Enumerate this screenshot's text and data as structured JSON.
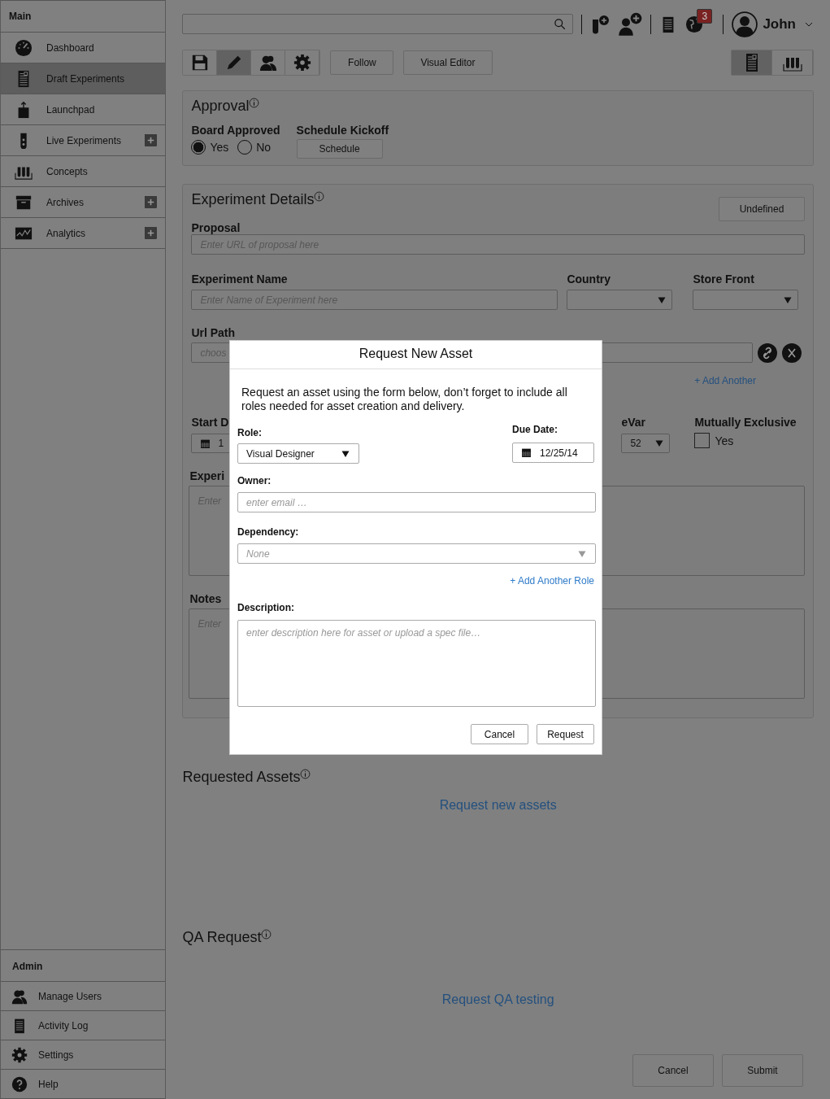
{
  "sidebar": {
    "main_heading": "Main",
    "items": [
      {
        "label": "Dashboard",
        "selected": false,
        "expandable": false
      },
      {
        "label": "Draft Experiments",
        "selected": true,
        "expandable": false
      },
      {
        "label": "Launchpad",
        "selected": false,
        "expandable": false
      },
      {
        "label": "Live Experiments",
        "selected": false,
        "expandable": true
      },
      {
        "label": "Concepts",
        "selected": false,
        "expandable": false
      },
      {
        "label": "Archives",
        "selected": false,
        "expandable": true
      },
      {
        "label": "Analytics",
        "selected": false,
        "expandable": true
      }
    ],
    "admin_heading": "Admin",
    "admin_items": [
      {
        "label": "Manage Users"
      },
      {
        "label": "Activity Log"
      },
      {
        "label": "Settings"
      },
      {
        "label": "Help"
      }
    ]
  },
  "topbar": {
    "notification_count": "3",
    "user_name": "John"
  },
  "toolbar": {
    "tools": [
      {
        "selected": false
      },
      {
        "selected": true
      },
      {
        "selected": false
      },
      {
        "selected": false
      }
    ],
    "buttons": [
      "Follow",
      "Visual Editor"
    ],
    "views": [
      {
        "selected": true
      },
      {
        "selected": false
      }
    ]
  },
  "approval": {
    "title": "Approval",
    "board_approved": {
      "label": "Board Approved",
      "options": [
        {
          "label": "Yes",
          "selected": true
        },
        {
          "label": "No",
          "selected": false
        }
      ]
    },
    "schedule_kickoff": {
      "label": "Schedule Kickoff",
      "button": "Schedule"
    }
  },
  "experiment_details": {
    "title": "Experiment Details",
    "status_button": "Undefined",
    "proposal": {
      "label": "Proposal",
      "placeholder": "Enter URL of proposal here"
    },
    "experiment_name": {
      "label": "Experiment Name",
      "placeholder": "Enter Name of Experiment here"
    },
    "country": {
      "label": "Country"
    },
    "store_front": {
      "label": "Store Front"
    },
    "url_path": {
      "label": "Url Path",
      "placeholder": "choos"
    },
    "add_another": "+ Add Another",
    "start_date": {
      "label": "Start D",
      "value": "1"
    },
    "evar": {
      "label": "eVar",
      "value": "52"
    },
    "mutually_exclusive": {
      "label": "Mutually Exclusive",
      "option": "Yes",
      "checked": false
    },
    "experiment_field": {
      "label": "Experi",
      "placeholder": "Enter"
    },
    "notes": {
      "label": "Notes",
      "placeholder": "Enter"
    }
  },
  "requested_assets": {
    "title": "Requested Assets",
    "link": "Request new assets"
  },
  "qa_request": {
    "title": "QA Request",
    "link": "Request QA testing"
  },
  "footer_buttons": [
    "Cancel",
    "Submit"
  ],
  "modal": {
    "title": "Request New Asset",
    "intro": "Request an asset using the form below, don’t forget to include all roles needed for asset creation and delivery.",
    "role": {
      "label": "Role:",
      "value": "Visual Designer"
    },
    "due_date": {
      "label": "Due Date:",
      "value": "12/25/14"
    },
    "owner": {
      "label": "Owner:",
      "placeholder": "enter email …"
    },
    "dependency": {
      "label": "Dependency:",
      "placeholder": "None"
    },
    "add_role": "+ Add Another Role",
    "description": {
      "label": "Description:",
      "placeholder": "enter description here for asset or upload a spec file…"
    },
    "buttons": [
      "Cancel",
      "Request"
    ]
  }
}
